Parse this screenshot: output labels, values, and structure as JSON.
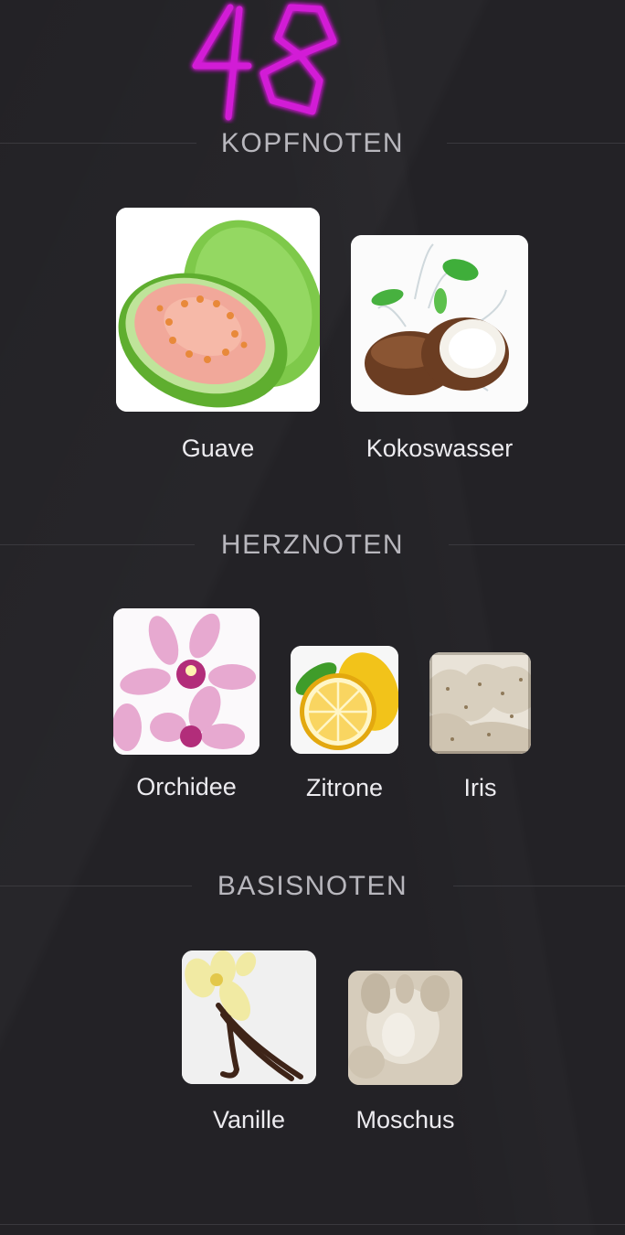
{
  "badge": {
    "number": "48"
  },
  "sections": [
    {
      "title": "KOPFNOTEN",
      "notes": [
        {
          "label": "Guave",
          "icon": "guava-image"
        },
        {
          "label": "Kokoswasser",
          "icon": "coconut-water-image"
        }
      ]
    },
    {
      "title": "HERZNOTEN",
      "notes": [
        {
          "label": "Orchidee",
          "icon": "orchid-image"
        },
        {
          "label": "Zitrone",
          "icon": "lemon-image"
        },
        {
          "label": "Iris",
          "icon": "iris-root-image"
        }
      ]
    },
    {
      "title": "BASISNOTEN",
      "notes": [
        {
          "label": "Vanille",
          "icon": "vanilla-image"
        },
        {
          "label": "Moschus",
          "icon": "musk-image"
        }
      ]
    }
  ],
  "colors": {
    "background": "#232226",
    "neon": "#d21fd6",
    "heading": "#b8b7bd",
    "label": "#ecebef"
  }
}
